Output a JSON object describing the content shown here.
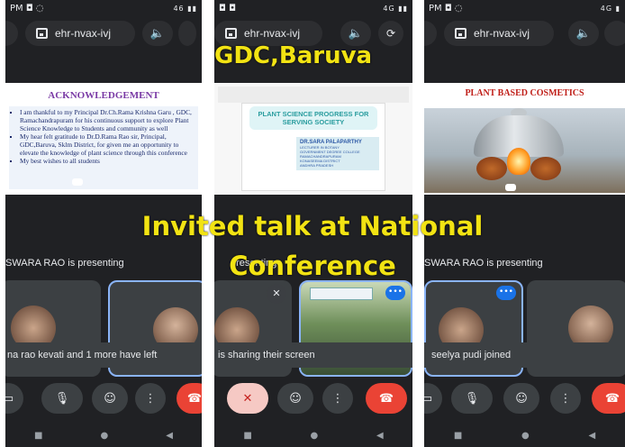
{
  "overlay": {
    "title_top": "GDC,Baruva",
    "title_line1": "Invited talk at National",
    "title_line2": "Conference"
  },
  "panels": [
    {
      "status_left": "PM ◘ ◌",
      "status_right": "46 ▮▮",
      "meeting_code": "ehr-nvax-ivj",
      "slide": {
        "title": "ACKNOWLEDGEMENT",
        "bullets": [
          "I am thankful to my Principal Dr.Ch.Rama Krishna Garu , GDC, Ramachandrapuram for his continuous support to explore Plant Science Knowledge to Students and community as well",
          "My hear felt gratitude to Dr.D.Rama Rao sir, Principal, GDC,Baruva, Sklm District, for given me an opportunity to elevate the knowledge of plant science through this conference",
          "My best wishes to all students"
        ]
      },
      "presenting_text": "SWARA RAO is presenting",
      "toast": "na rao kevati and 1 more have left"
    },
    {
      "status_left": "◘ ◘",
      "status_right": "4G ▮▮",
      "slide": {
        "title": "PLANT SCIENCE  PROGRESS FOR SERVING SOCIETY",
        "presenter_name": "DR.SARA PALAPARTHY",
        "presenter_lines": [
          "LECTURER IN BOTANY",
          "GOVERNMENT DEGREE COLLEGE",
          "RAMACHANDRAPURAM",
          "KONASEEMA DISTRICT",
          "ANDHRA PRADESH"
        ]
      },
      "presenting_text": "presenting",
      "toast": "is sharing their screen"
    },
    {
      "status_left": "PM ◘ ◌",
      "status_right": "4G ▮",
      "meeting_code": "ehr-nvax-ivj",
      "slide": {
        "title": "PLANT BASED COSMETICS"
      },
      "presenting_text": "SWARA RAO is presenting",
      "toast": "seelya pudi joined"
    }
  ],
  "icons": {
    "speaker": "🔈",
    "mic": "🎙",
    "emoji": "☺",
    "more": "⋮",
    "end_call": "☎",
    "camera": "▭",
    "flip": "⟳",
    "nav_recents": "■",
    "nav_home": "●",
    "nav_back": "◀",
    "dots": "•••",
    "mic_off": "✕"
  },
  "colors": {
    "meet_dark": "#202124",
    "end_call_red": "#ea4335",
    "overlay_yellow": "#f2e313",
    "ack_purple": "#7a3aa5",
    "cosmetics_red": "#c0201a"
  }
}
